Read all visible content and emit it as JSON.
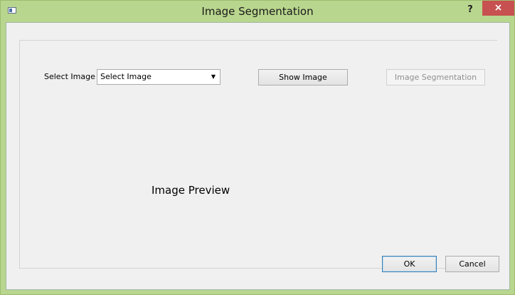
{
  "window": {
    "title": "Image Segmentation",
    "help_label": "?",
    "close_label": "×"
  },
  "form": {
    "select_label": "Select Image",
    "combo_value": "Select Image",
    "show_button": "Show Image",
    "segment_button": "Image Segmentation",
    "preview_label": "Image Preview",
    "ok_button": "OK",
    "cancel_button": "Cancel"
  },
  "colors": {
    "titlebar": "#b9d68e",
    "close_button": "#c75050",
    "client_bg": "#f0f0f0"
  }
}
